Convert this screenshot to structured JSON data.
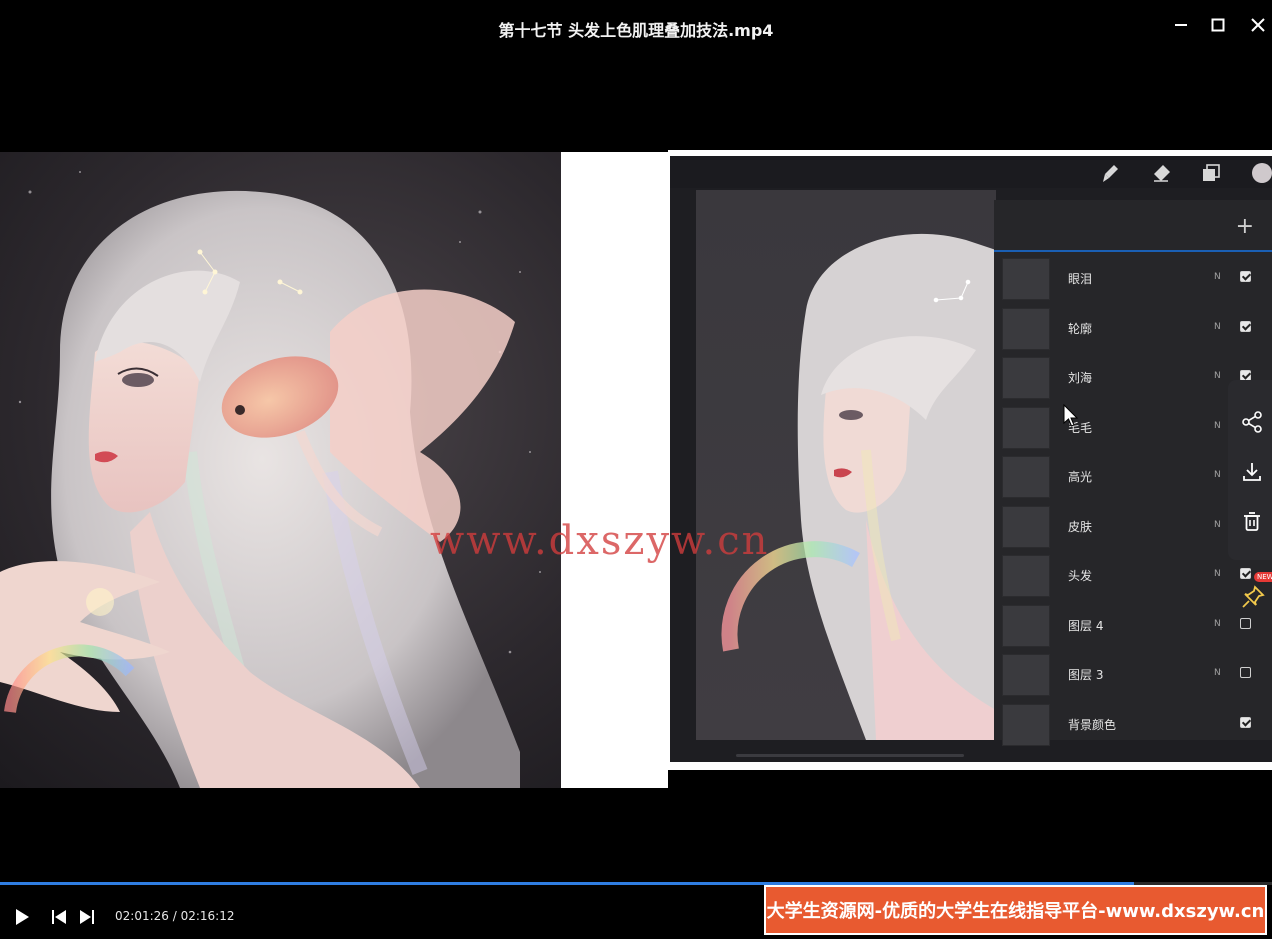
{
  "window": {
    "title": "第十七节 头发上色肌理叠加技法.mp4",
    "minimize_icon": "minimize-icon",
    "maximize_icon": "maximize-icon",
    "close_icon": "close-icon"
  },
  "procreate": {
    "tools": [
      "brush-icon",
      "eraser-icon",
      "layers-icon",
      "color-icon"
    ],
    "layers_panel": {
      "add_icon": "plus-icon",
      "add_label": "+",
      "layers": [
        {
          "name": "眼泪",
          "blend": "N",
          "visible": true
        },
        {
          "name": "轮廓",
          "blend": "N",
          "visible": true
        },
        {
          "name": "刘海",
          "blend": "N",
          "visible": true
        },
        {
          "name": "毛毛",
          "blend": "N",
          "visible": true
        },
        {
          "name": "高光",
          "blend": "N",
          "visible": true
        },
        {
          "name": "皮肤",
          "blend": "N",
          "visible": true
        },
        {
          "name": "头发",
          "blend": "N",
          "visible": true
        },
        {
          "name": "图层 4",
          "blend": "N",
          "visible": false
        },
        {
          "name": "图层 3",
          "blend": "N",
          "visible": false
        },
        {
          "name": "背景颜色",
          "blend": "",
          "visible": true
        }
      ]
    }
  },
  "side_tools": {
    "share_icon": "share-icon",
    "download_icon": "download-icon",
    "delete_icon": "trash-icon",
    "pin_icon": "pin-icon",
    "new_badge": "NEW"
  },
  "watermark": "www.dxszyw.cn",
  "player": {
    "current_time": "02:01:26",
    "total_time": "02:16:12",
    "time_display": "02:01:26 / 02:16:12",
    "progress": 0.8917,
    "play_icon": "play-icon",
    "prev_icon": "skip-previous-icon",
    "next_icon": "skip-next-icon"
  },
  "banner": {
    "text": "大学生资源网-优质的大学生在线指导平台-www.dxszyw.cn"
  }
}
